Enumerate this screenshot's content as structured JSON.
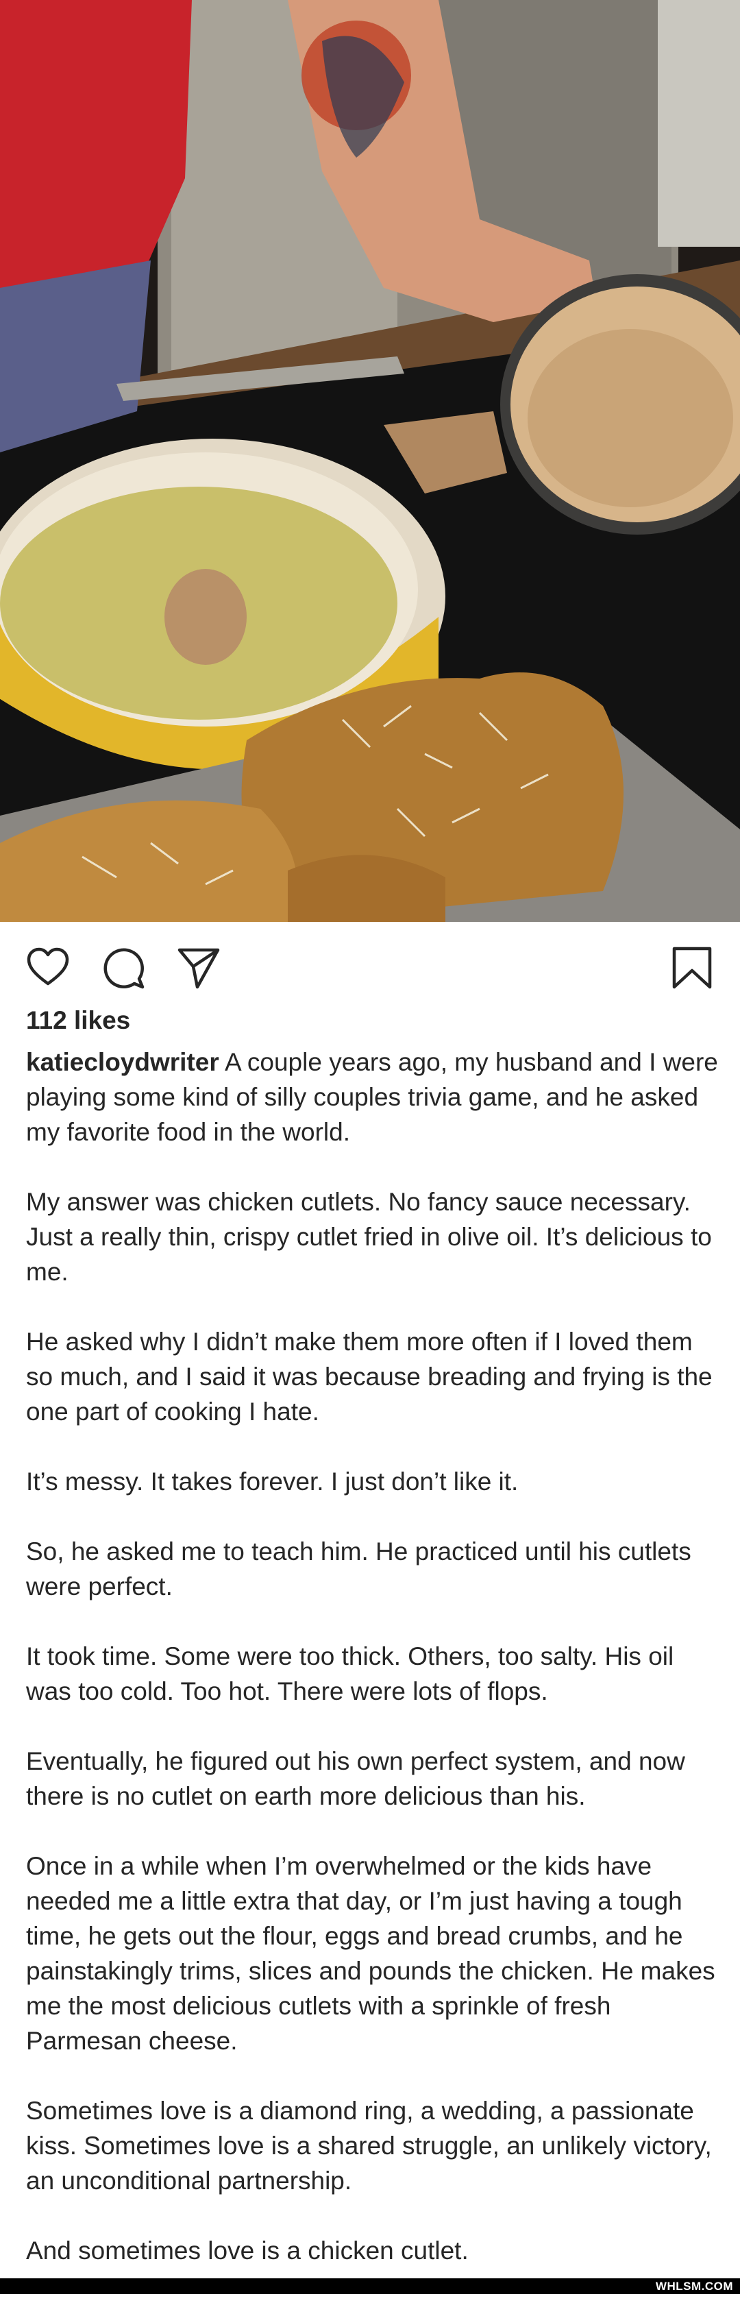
{
  "post": {
    "likes": "112 likes",
    "username": "katiecloydwriter",
    "paragraphs": [
      "A couple years ago, my husband and I were playing some kind of silly couples trivia game, and he asked my favorite food in the world.",
      "My answer was chicken cutlets. No fancy sauce necessary. Just a really thin, crispy cutlet fried in olive oil. It’s delicious to me.",
      "He asked why I didn’t make them more often if I loved them so much, and I said it was because breading and frying is the one part of cooking I hate.",
      "It’s messy. It takes forever. I just don’t like it.",
      "So, he asked me to teach him. He practiced until his cutlets were perfect.",
      "It took time. Some were too thick. Others, too salty. His oil was too cold. Too hot. There were lots of flops.",
      "Eventually, he figured out his own perfect system, and now there is no cutlet on earth more delicious than his.",
      "Once in a while when I’m overwhelmed or the kids have needed me a little extra that day, or I’m just having a tough time, he gets out the flour, eggs and bread crumbs, and he painstakingly trims, slices and pounds the chicken. He makes me the most delicious cutlets with a sprinkle of fresh Parmesan cheese.",
      "Sometimes love is a diamond ring, a wedding, a passionate kiss. Sometimes love is a shared struggle, an unlikely victory, an unconditional partnership.",
      "And sometimes love is a chicken cutlet."
    ]
  },
  "icons": {
    "like": "heart-icon",
    "comment": "comment-bubble-icon",
    "share": "paper-plane-icon",
    "save": "bookmark-icon"
  },
  "watermark": "WHLSM.COM"
}
